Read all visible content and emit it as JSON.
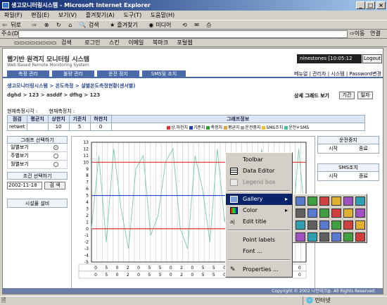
{
  "window": {
    "title": "생고모니터링시스템 - Microsoft Internet Explorer"
  },
  "menubar": [
    "파일(F)",
    "편집(E)",
    "보기(V)",
    "즐겨찾기(A)",
    "도구(T)",
    "도움말(H)"
  ],
  "toolbar": {
    "back": "뒤로",
    "search": "검색",
    "favorites": "즐겨찾기",
    "media": "미디어"
  },
  "address": {
    "label": "주소(D)",
    "go": "이동",
    "links": "연결"
  },
  "linksbar": {
    "search": "검색",
    "login": "로그인",
    "skin": "스킨",
    "email": "이메일",
    "bookmark": "북마크",
    "portal": "포털웹"
  },
  "app": {
    "title": "웹기반 원격지 모니터링 시스템",
    "subtitle": "Web Based Remote Monitoring System",
    "user": "ninestones [10:05:12 AM]",
    "logout": "Logout",
    "tabs": [
      "측정 관리",
      "불량 관리",
      "운전 정지",
      "SMS및 조치"
    ],
    "toplinks": "메뉴얼 | 관리자 | 시스템 | Password변경",
    "crumb": "생고모니터링시스템 > 온도측정 > 설별온도측정현황(센서별)",
    "path": "dghd > 123 > asddf > dfhg > 123",
    "detail_label": "상세 그래드 보기",
    "btn_period": "기간",
    "btn_day": "일자",
    "meas_time_label": "현재측정시각 :",
    "meas_value_label": "현재측정치 :"
  },
  "table": {
    "headers": [
      "점검",
      "평균치",
      "상한치",
      "기준치",
      "하한치",
      "그래프정보"
    ],
    "row": [
      "retwet",
      "",
      "10",
      "5",
      "0"
    ],
    "legend": [
      {
        "label": "상.하한치",
        "color": "#e03030"
      },
      {
        "label": "기준치",
        "color": "#2040c0"
      },
      {
        "label": "측정치",
        "color": "#30a030"
      },
      {
        "label": "평균치",
        "color": "#e0a040"
      },
      {
        "label": "운전중지",
        "color": "#a0a0a0"
      },
      {
        "label": "SMS조치",
        "color": "#f0c020"
      },
      {
        "label": "운전+SMS",
        "color": "#40c0a0"
      }
    ]
  },
  "left": {
    "graph_select": "그래프 선택하기",
    "options": [
      "일별보기",
      "주별보기",
      "월별보기"
    ],
    "cond_select": "조건 선택하기",
    "date": "2002-11-18",
    "search": "검 색",
    "equipment": "시설물 설비"
  },
  "right": {
    "run_stop": "운전중지",
    "sms": "SMS조치",
    "start": "시작",
    "end": "종료"
  },
  "chart_data": {
    "type": "line",
    "y_ticks": [
      "13",
      "12",
      "11",
      "10",
      "9",
      "8",
      "7",
      "6",
      "5",
      "4",
      "3",
      "2",
      "1",
      "0",
      "-1",
      "-2",
      "-3",
      "-4",
      "-5"
    ],
    "ylim": [
      -5,
      13
    ],
    "lines": [
      {
        "name": "",
        "value": 10,
        "color": "#e03030"
      },
      {
        "name": "",
        "value": 5,
        "color": "#2040c0"
      },
      {
        "name": "",
        "value": 0,
        "color": "#e03030"
      }
    ],
    "series": [
      {
        "name": "",
        "color": "#7cc8a8",
        "values": [
          0,
          11,
          -2,
          12,
          3,
          -3,
          9,
          11,
          -1,
          2,
          10,
          12,
          0,
          -3,
          11,
          6,
          -2,
          12,
          1,
          9,
          -3,
          11,
          4,
          12,
          -1,
          10,
          7,
          -2,
          12,
          0
        ]
      }
    ],
    "x_row1": [
      "0",
      "5",
      "0",
      "2",
      "0",
      "5",
      "5",
      "0",
      "2",
      "0",
      "5",
      "5",
      "0",
      "2",
      "3",
      "2",
      "0",
      "0",
      "0",
      "0"
    ],
    "x_row2": [
      "0",
      "5",
      "0",
      "2",
      "0",
      "5",
      "5",
      "0",
      "2",
      "0",
      "5",
      "5",
      "0",
      "2",
      "3",
      "2",
      "0",
      "0",
      "0",
      "0"
    ]
  },
  "context_menu": {
    "items": [
      "Toolbar",
      "Data Editor",
      "Legend box",
      "Gallery",
      "Color",
      "Edit title",
      "Point labels",
      "Font ...",
      "Properties ..."
    ]
  },
  "footer": {
    "copyright": "Copyright © 2002 나인테크놀. All Rights Reserved."
  },
  "status": {
    "zone": "인터넷"
  }
}
